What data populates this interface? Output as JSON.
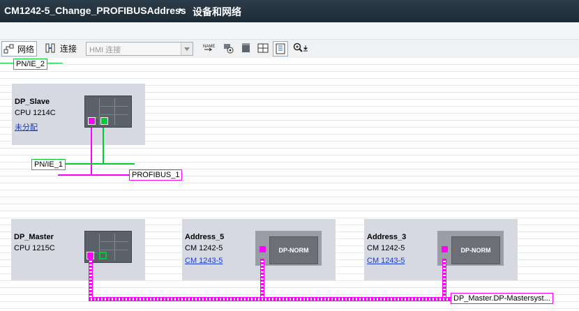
{
  "title": {
    "project": "CM1242-5_Change_PROFIBUSAddress",
    "separator": "▸",
    "section": "设备和网络"
  },
  "toolbar": {
    "network_label": "网络",
    "connect_label": "连接",
    "hmi_combo": "HMI 连接",
    "icons": [
      "network-view-icon",
      "connections-icon",
      "name-icon",
      "show-addresses-icon",
      "properties-icon",
      "grid-icon",
      "table-view-icon",
      "zoom-icon"
    ]
  },
  "networks": {
    "pn_ie_2": "PN/IE_2",
    "pn_ie_1": "PN/IE_1",
    "profibus_1": "PROFIBUS_1",
    "master_system": "DP_Master.DP-Mastersyst..."
  },
  "devices": {
    "dp_slave": {
      "name": "DP_Slave",
      "type": "CPU 1214C",
      "link": "未分配"
    },
    "dp_master": {
      "name": "DP_Master",
      "type": "CPU 1215C"
    },
    "address_5": {
      "name": "Address_5",
      "type": "CM 1242-5",
      "link": "CM 1243-5",
      "module_label": "DP-NORM"
    },
    "address_3": {
      "name": "Address_3",
      "type": "CM 1242-5",
      "link": "CM 1243-5",
      "module_label": "DP-NORM"
    }
  },
  "colors": {
    "profibus": "#ff00ff",
    "profinet": "#00cc33",
    "device_bg": "#d6d8e2",
    "title_bg": "#1c2a35"
  }
}
